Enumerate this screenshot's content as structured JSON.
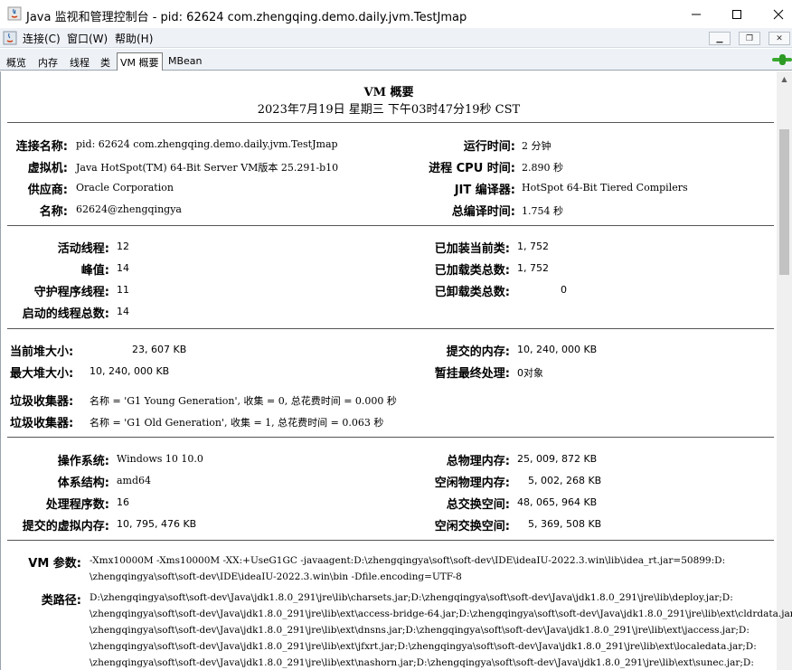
{
  "window": {
    "title": "Java 监视和管理控制台 - pid: 62624 com.zhengqing.demo.daily.jvm.TestJmap"
  },
  "menu": {
    "items": [
      "连接(C)",
      "窗口(W)",
      "帮助(H)"
    ]
  },
  "tabs": [
    "概览",
    "内存",
    "线程",
    "类",
    "VM 概要",
    "MBean"
  ],
  "active_tab": "VM 概要",
  "header": {
    "title": "VM 概要",
    "datetime": "2023年7月19日 星期三 下午03时47分19秒 CST"
  },
  "section1": {
    "left": [
      {
        "label": "连接名称:",
        "value": "pid: 62624 com.zhengqing.demo.daily.jvm.TestJmap"
      },
      {
        "label": "虚拟机:",
        "value": "Java HotSpot(TM) 64-Bit Server VM版本 25.291-b10"
      },
      {
        "label": "供应商:",
        "value": "Oracle Corporation"
      },
      {
        "label": "名称:",
        "value": "62624@zhengqingya"
      }
    ],
    "right": [
      {
        "label": "运行时间:",
        "value": "2 分钟"
      },
      {
        "label": "进程 CPU 时间:",
        "value": "2.890 秒"
      },
      {
        "label": "JIT 编译器:",
        "value": "HotSpot 64-Bit Tiered Compilers"
      },
      {
        "label": "总编译时间:",
        "value": "1.754 秒"
      }
    ]
  },
  "section2": {
    "left": [
      {
        "label": "活动线程:",
        "value": "12"
      },
      {
        "label": "峰值:",
        "value": "14"
      },
      {
        "label": "守护程序线程:",
        "value": "11"
      },
      {
        "label": "启动的线程总数:",
        "value": "14"
      }
    ],
    "right": [
      {
        "label": "已加装当前类:",
        "value": "1, 752"
      },
      {
        "label": "已加载类总数:",
        "value": "1, 752"
      },
      {
        "label": "已卸载类总数:",
        "value": "0"
      }
    ]
  },
  "section3": {
    "left": [
      {
        "label": "当前堆大小:",
        "value": "23, 607 KB"
      },
      {
        "label": "最大堆大小:",
        "value": "10, 240, 000 KB"
      }
    ],
    "right": [
      {
        "label": "提交的内存:",
        "value": "10, 240, 000 KB"
      },
      {
        "label": "暂挂最终处理:",
        "value": "0对象"
      }
    ],
    "gc": [
      {
        "label": "垃圾收集器:",
        "value": "名称 = 'G1 Young Generation', 收集 = 0, 总花费时间 = 0.000 秒"
      },
      {
        "label": "垃圾收集器:",
        "value": "名称 = 'G1 Old Generation', 收集 = 1, 总花费时间 = 0.063 秒"
      }
    ]
  },
  "section4": {
    "left": [
      {
        "label": "操作系统:",
        "value": "Windows 10 10.0"
      },
      {
        "label": "体系结构:",
        "value": "amd64"
      },
      {
        "label": "处理程序数:",
        "value": "16"
      },
      {
        "label": "提交的虚拟内存:",
        "value": "10, 795, 476 KB"
      }
    ],
    "right": [
      {
        "label": "总物理内存:",
        "value": "25, 009, 872 KB"
      },
      {
        "label": "空闲物理内存:",
        "value": "5, 002, 268 KB"
      },
      {
        "label": "总交换空间:",
        "value": "48, 065, 964 KB"
      },
      {
        "label": "空闲交换空间:",
        "value": "5, 369, 508 KB"
      }
    ]
  },
  "section5": {
    "vm_args_label": "VM 参数:",
    "vm_args_lines": [
      "-Xmx10000M -Xms10000M -XX:+UseG1GC -javaagent:D:\\zhengqingya\\soft\\soft-dev\\IDE\\ideaIU-2022.3.win\\lib\\idea_rt.jar=50899:D:",
      "\\zhengqingya\\soft\\soft-dev\\IDE\\ideaIU-2022.3.win\\bin -Dfile.encoding=UTF-8"
    ],
    "classpath_label": "类路径:",
    "classpath_lines": [
      "D:\\zhengqingya\\soft\\soft-dev\\Java\\jdk1.8.0_291\\jre\\lib\\charsets.jar;D:\\zhengqingya\\soft\\soft-dev\\Java\\jdk1.8.0_291\\jre\\lib\\deploy.jar;D:",
      "\\zhengqingya\\soft\\soft-dev\\Java\\jdk1.8.0_291\\jre\\lib\\ext\\access-bridge-64.jar;D:\\zhengqingya\\soft\\soft-dev\\Java\\jdk1.8.0_291\\jre\\lib\\ext\\cldrdata.jar;D:",
      "\\zhengqingya\\soft\\soft-dev\\Java\\jdk1.8.0_291\\jre\\lib\\ext\\dnsns.jar;D:\\zhengqingya\\soft\\soft-dev\\Java\\jdk1.8.0_291\\jre\\lib\\ext\\jaccess.jar;D:",
      "\\zhengqingya\\soft\\soft-dev\\Java\\jdk1.8.0_291\\jre\\lib\\ext\\jfxrt.jar;D:\\zhengqingya\\soft\\soft-dev\\Java\\jdk1.8.0_291\\jre\\lib\\ext\\localedata.jar;D:",
      "\\zhengqingya\\soft\\soft-dev\\Java\\jdk1.8.0_291\\jre\\lib\\ext\\nashorn.jar;D:\\zhengqingya\\soft\\soft-dev\\Java\\jdk1.8.0_291\\jre\\lib\\ext\\sunec.jar;D:"
    ]
  }
}
